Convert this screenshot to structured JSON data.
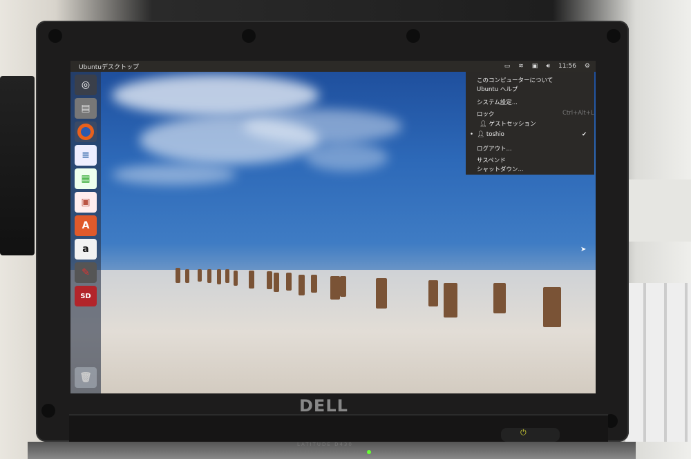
{
  "panel": {
    "title": "Ubuntuデスクトップ",
    "clock": "11:56",
    "indicators": [
      "keyboard-icon",
      "wifi-icon",
      "battery-icon",
      "volume-icon",
      "gear-icon"
    ]
  },
  "launcher": {
    "items": [
      {
        "name": "ubuntu-dash",
        "icon": "ubuntu-logo-icon"
      },
      {
        "name": "files",
        "icon": "files-icon"
      },
      {
        "name": "firefox",
        "icon": "firefox-icon"
      },
      {
        "name": "writer",
        "icon": "libreoffice-writer-icon"
      },
      {
        "name": "calc",
        "icon": "libreoffice-calc-icon"
      },
      {
        "name": "impress",
        "icon": "libreoffice-impress-icon"
      },
      {
        "name": "software-center",
        "icon": "software-center-icon",
        "label": "A"
      },
      {
        "name": "amazon",
        "icon": "amazon-icon",
        "label": "a"
      },
      {
        "name": "system-settings",
        "icon": "settings-icon"
      },
      {
        "name": "sd-card",
        "icon": "sd-card-icon",
        "label": "SD"
      },
      {
        "name": "trash",
        "icon": "trash-icon"
      }
    ]
  },
  "session_menu": {
    "about": "このコンピューターについて",
    "help": "Ubuntu ヘルプ",
    "settings": "システム設定...",
    "lock": "ロック",
    "lock_shortcut": "Ctrl+Alt+L",
    "guest": "ゲストセッション",
    "user": "toshio",
    "logout": "ログアウト...",
    "suspend": "サスペンド",
    "shutdown": "シャットダウン..."
  },
  "hardware": {
    "brand": "DELL",
    "model": "LATITUDE D430"
  },
  "colors": {
    "panel": "#2c2a27",
    "menu": "#2b2927",
    "accent": "#e05a2b"
  }
}
